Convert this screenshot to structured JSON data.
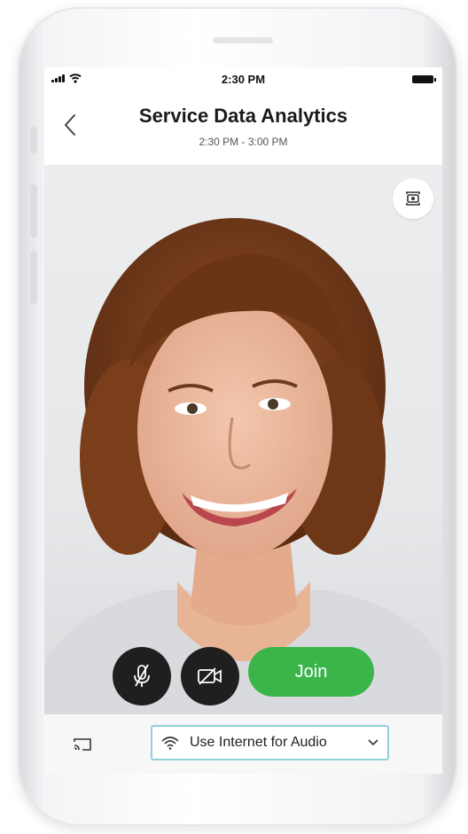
{
  "status_bar": {
    "time": "2:30 PM"
  },
  "header": {
    "title": "Service Data Analytics",
    "subtitle": "2:30 PM - 3:00 PM"
  },
  "controls": {
    "join_label": "Join",
    "join_color": "#3bb54a"
  },
  "audio_selector": {
    "label": "Use Internet for Audio",
    "border_color": "#8fd1d9"
  },
  "icons": [
    "back-chevron-icon",
    "camera-switch-icon",
    "mic-muted-icon",
    "video-off-icon",
    "cast-icon",
    "wifi-icon",
    "chevron-down-icon"
  ]
}
